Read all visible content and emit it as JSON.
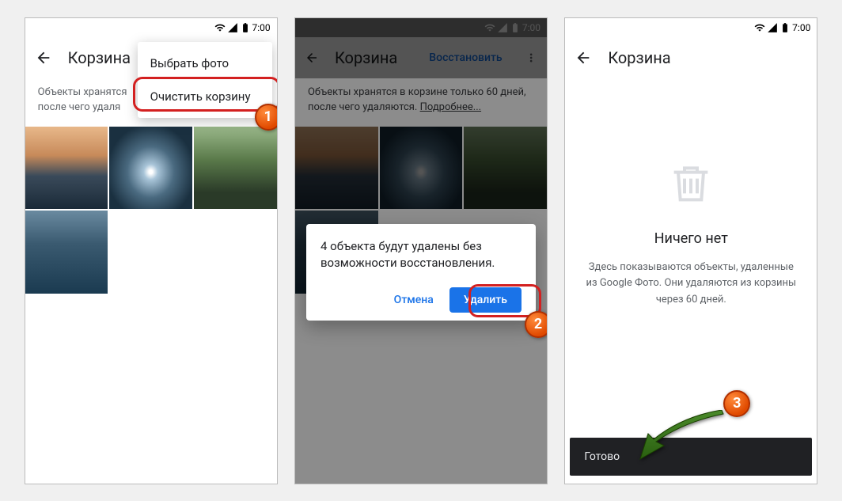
{
  "status": {
    "time": "7:00"
  },
  "screen1": {
    "title": "Корзина",
    "info_line1": "Объекты хранятся",
    "info_line2": "после чего удаля",
    "menu": {
      "select": "Выбрать фото",
      "empty": "Очистить корзину"
    },
    "step": "1"
  },
  "screen2": {
    "title": "Корзина",
    "restore": "Восстановить",
    "info": "Объекты хранятся в корзине только 60 дней, после чего удаляются.",
    "more": "Подробнее...",
    "dialog": {
      "text": "4 объекта будут удалены без возможности восстановления.",
      "cancel": "Отмена",
      "delete": "Удалить"
    },
    "step": "2"
  },
  "screen3": {
    "title": "Корзина",
    "empty_title": "Ничего нет",
    "empty_sub": "Здесь показываются объекты, удаленные из Google Фото. Они удаляются из корзины через 60 дней.",
    "snackbar": "Готово",
    "step": "3"
  }
}
